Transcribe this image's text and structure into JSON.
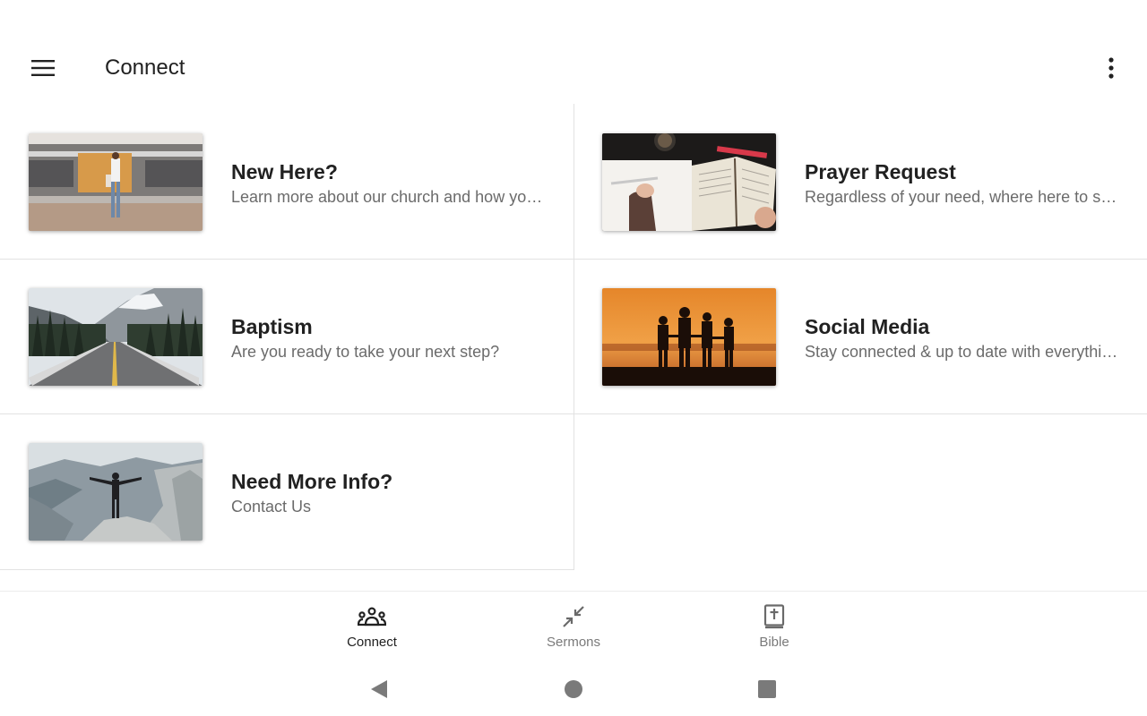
{
  "appbar": {
    "title": "Connect",
    "menu_icon": "hamburger-menu-icon",
    "more_icon": "more-vert-icon"
  },
  "cards": [
    {
      "title": "New Here?",
      "subtitle": "Learn more about our church and how you can get connected",
      "image": "train-station-photo"
    },
    {
      "title": "Prayer Request",
      "subtitle": "Regardless of your need, where here to support and pray with you",
      "image": "bible-journal-photo"
    },
    {
      "title": "Baptism",
      "subtitle": "Are you ready to take your next step?",
      "image": "mountain-road-photo"
    },
    {
      "title": "Social Media",
      "subtitle": "Stay connected & up to date with everything happening",
      "image": "sunset-silhouettes-photo"
    },
    {
      "title": "Need More Info?",
      "subtitle": "Contact Us",
      "image": "cliff-person-photo"
    }
  ],
  "bottom_nav": {
    "items": [
      {
        "label": "Connect",
        "icon": "people-group-icon",
        "active": true
      },
      {
        "label": "Sermons",
        "icon": "collapse-arrows-icon",
        "active": false
      },
      {
        "label": "Bible",
        "icon": "bible-book-icon",
        "active": false
      }
    ]
  },
  "system_nav": {
    "back_icon": "back-triangle-icon",
    "home_icon": "home-circle-icon",
    "recents_icon": "recents-square-icon"
  },
  "colors": {
    "background": "#ffffff",
    "divider": "#e2e2e2",
    "title_text": "#212121",
    "subtitle_text": "#6b6b6b",
    "inactive_nav": "#7a7a7a"
  }
}
